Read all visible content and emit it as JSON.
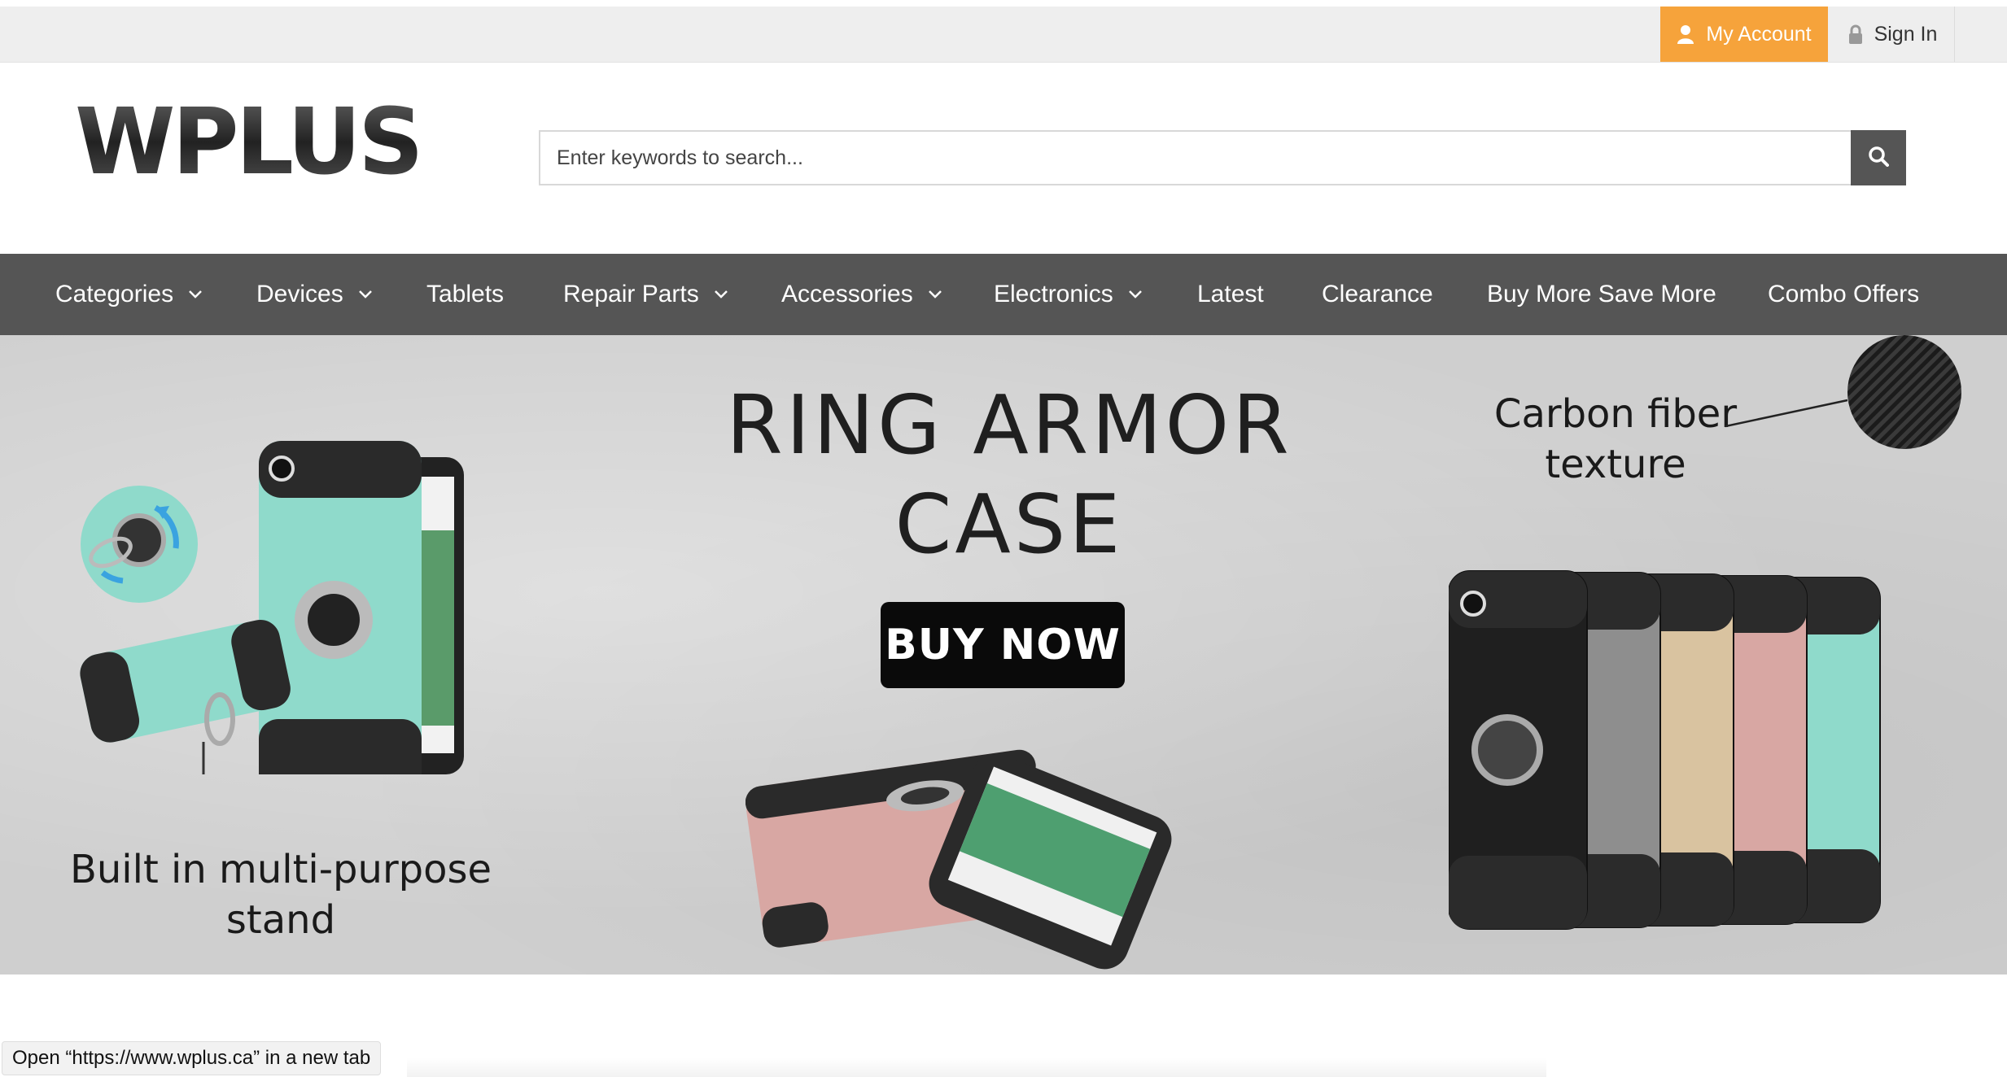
{
  "topbar": {
    "my_account_label": "My Account",
    "sign_in_label": "Sign In",
    "account_color": "#f6a33b"
  },
  "header": {
    "logo_text": "WPLUS",
    "search_placeholder": "Enter keywords to search..."
  },
  "nav": {
    "items": [
      {
        "label": "Categories",
        "dropdown": true
      },
      {
        "label": "Devices",
        "dropdown": true
      },
      {
        "label": "Tablets",
        "dropdown": false
      },
      {
        "label": "Repair Parts",
        "dropdown": true
      },
      {
        "label": "Accessories",
        "dropdown": true
      },
      {
        "label": "Electronics",
        "dropdown": true
      },
      {
        "label": "Latest",
        "dropdown": false
      },
      {
        "label": "Clearance",
        "dropdown": false
      },
      {
        "label": "Buy More Save More",
        "dropdown": false
      },
      {
        "label": "Combo Offers",
        "dropdown": false
      }
    ],
    "background": "#555555"
  },
  "hero": {
    "title_line1": "RING ARMOR",
    "title_line2": "CASE",
    "buy_now_label": "BUY NOW",
    "caption_left_line1": "Built in multi-purpose",
    "caption_left_line2": "stand",
    "caption_right_line1": "Carbon fiber",
    "caption_right_line2": "texture",
    "case_colors": [
      "#1f1f1f",
      "#8e8e8e",
      "#d9c3a0",
      "#d8a7a3",
      "#8fdacb"
    ]
  },
  "status": {
    "link_hover_text": "Open “https://www.wplus.ca” in a new tab"
  }
}
